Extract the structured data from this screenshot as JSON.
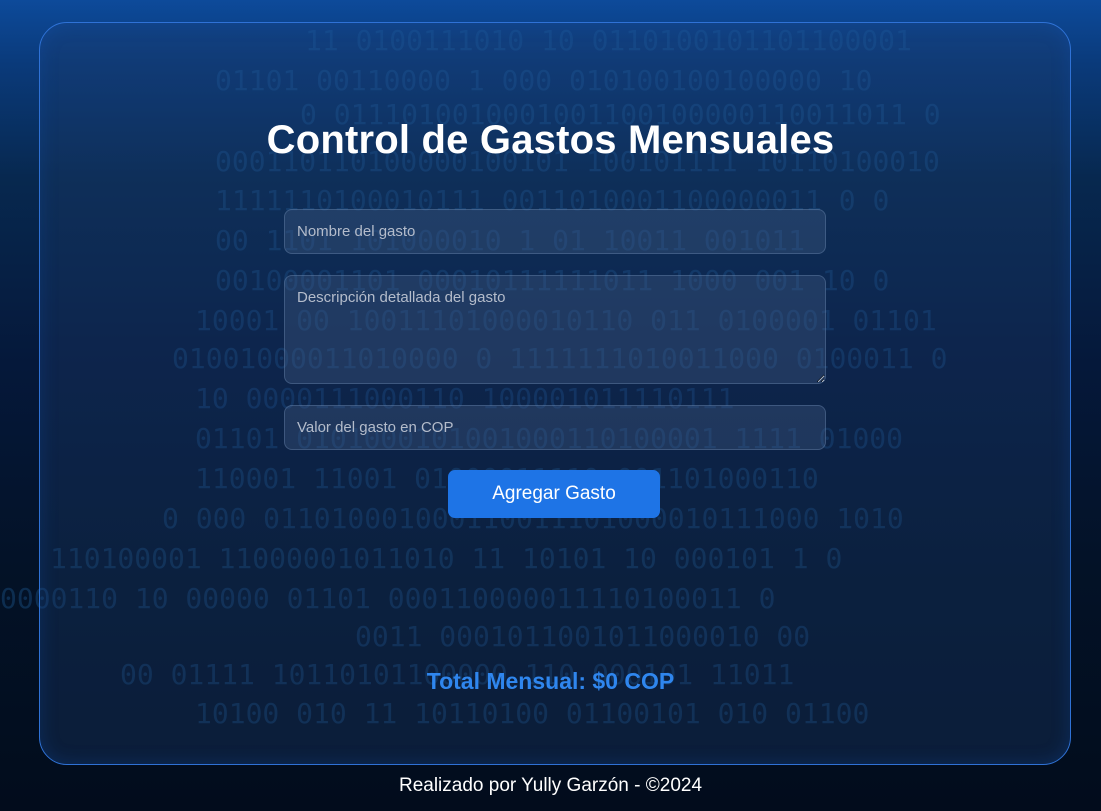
{
  "background_binary": [
    "11 0100111010 10 0110100101101100001",
    "01101 00110000 1 000 010100100100000 10",
    "0 0111010010001001100100000110011011 0",
    "000110110100000100101 100101111 10110100010",
    "1111110100010111 0011010001100000011 0 0",
    "00 1101 101000010 1 01 10011 001011",
    "00100001101 00010111111011 1000 001 10 0",
    "10001 00 10011101000010110 011 0100001 01101",
    "01001000011010000 0 1111111010011000 0100011 0",
    "10 0000111000110 100001011110111",
    "01101 0101000101001000110100001 1111 01000",
    "110001 11001 01000011110 001101000110",
    "0 000 011010001000110011101000010111000 1010",
    "110100001 11000001011010 11 10101 10 000101 1 0",
    "0000110 10 00000 01101 000110000011110100011 0",
    "0011 0001011001011000010 00",
    "00 01111 10110101100000 110 000101 11011",
    "10100 010 11 10110100 01100101 010 01100"
  ],
  "card": {
    "title": "Control de Gastos Mensuales"
  },
  "form": {
    "name_placeholder": "Nombre del gasto",
    "description_placeholder": "Descripción detallada del gasto",
    "value_placeholder": "Valor del gasto en COP",
    "add_button_label": "Agregar Gasto"
  },
  "total": {
    "label": "Total Mensual: $0 COP"
  },
  "footer": {
    "text": "Realizado por Yully Garzón - ©2024"
  },
  "colors": {
    "accent": "#1e74e6",
    "total_text": "#2f86ee",
    "card_border": "#2f72d6"
  }
}
